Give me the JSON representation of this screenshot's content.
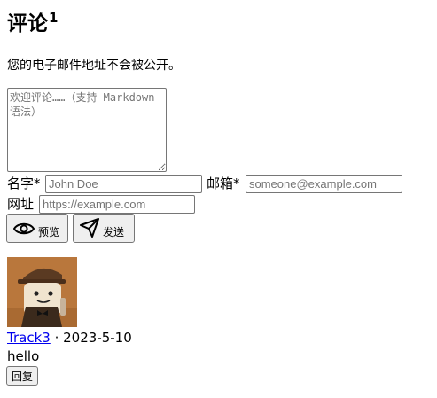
{
  "comments": {
    "title": "评论",
    "count": "1",
    "notice": "您的电子邮件地址不会被公开。",
    "form": {
      "textarea_placeholder": "欢迎评论……（支持 Markdown 语法）",
      "name_label": "名字*",
      "name_placeholder": "John Doe",
      "email_label": "邮箱*",
      "email_placeholder": "someone@example.com",
      "website_label": "网址",
      "website_placeholder": "https://example.com",
      "preview_label": "预览",
      "preview_icon": "eye-icon",
      "submit_label": "发送",
      "submit_icon": "send-icon"
    },
    "list": [
      {
        "author": "Track3",
        "separator": "·",
        "date": "2023-5-10",
        "content": "hello",
        "reply_label": "回复",
        "avatar": "avatar-image"
      }
    ]
  }
}
